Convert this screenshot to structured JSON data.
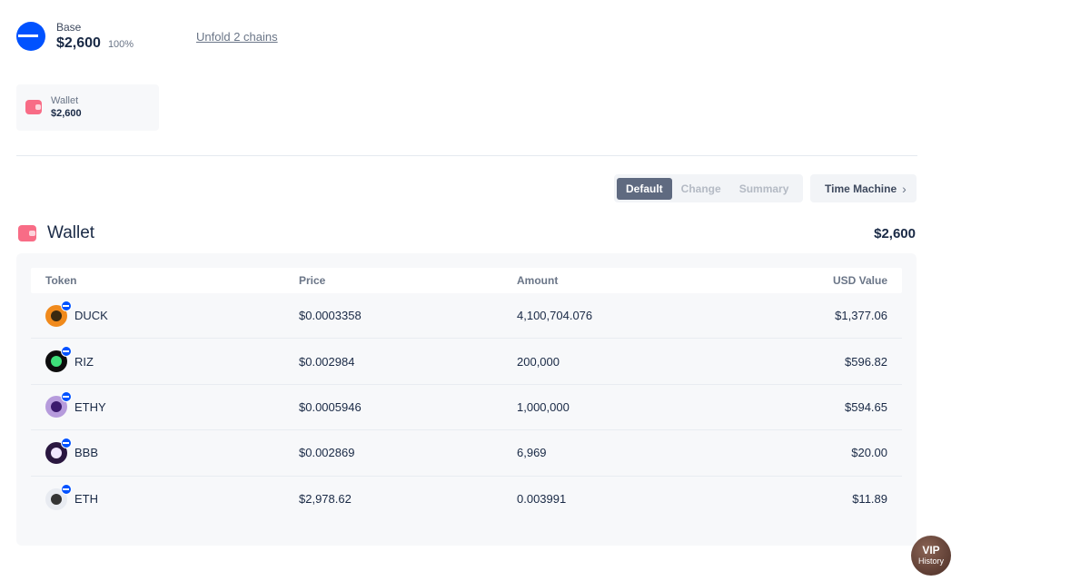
{
  "chain": {
    "name": "Base",
    "value": "$2,600",
    "percent": "100%",
    "color": "#0052ff"
  },
  "unfold_label": "Unfold 2 chains",
  "wallet_card": {
    "label": "Wallet",
    "value": "$2,600",
    "icon": "wallet-icon",
    "color": "#f86c86"
  },
  "view_toggle": {
    "options": [
      "Default",
      "Change",
      "Summary"
    ],
    "selected": "Default"
  },
  "time_machine_label": "Time Machine",
  "section": {
    "title": "Wallet",
    "total": "$2,600"
  },
  "table": {
    "headers": {
      "token": "Token",
      "price": "Price",
      "amount": "Amount",
      "usd_value": "USD Value"
    },
    "rows": [
      {
        "token": "DUCK",
        "price": "$0.0003358",
        "amount": "4,100,704.076",
        "usd_value": "$1,377.06",
        "logo_color": "#f08a1c",
        "logo_inner": "#3a2a10"
      },
      {
        "token": "RIZ",
        "price": "$0.002984",
        "amount": "200,000",
        "usd_value": "$596.82",
        "logo_color": "#0d0d0d",
        "logo_inner": "#3ee07a"
      },
      {
        "token": "ETHY",
        "price": "$0.0005946",
        "amount": "1,000,000",
        "usd_value": "$594.65",
        "logo_color": "#b69bdc",
        "logo_inner": "#3b1a6e"
      },
      {
        "token": "BBB",
        "price": "$0.002869",
        "amount": "6,969",
        "usd_value": "$20.00",
        "logo_color": "#2a1740",
        "logo_inner": "#f0e6ff"
      },
      {
        "token": "ETH",
        "price": "$2,978.62",
        "amount": "0.003991",
        "usd_value": "$11.89",
        "logo_color": "#e8ebf1",
        "logo_inner": "#343434"
      }
    ]
  },
  "vip": {
    "title": "VIP",
    "subtitle": "History"
  }
}
